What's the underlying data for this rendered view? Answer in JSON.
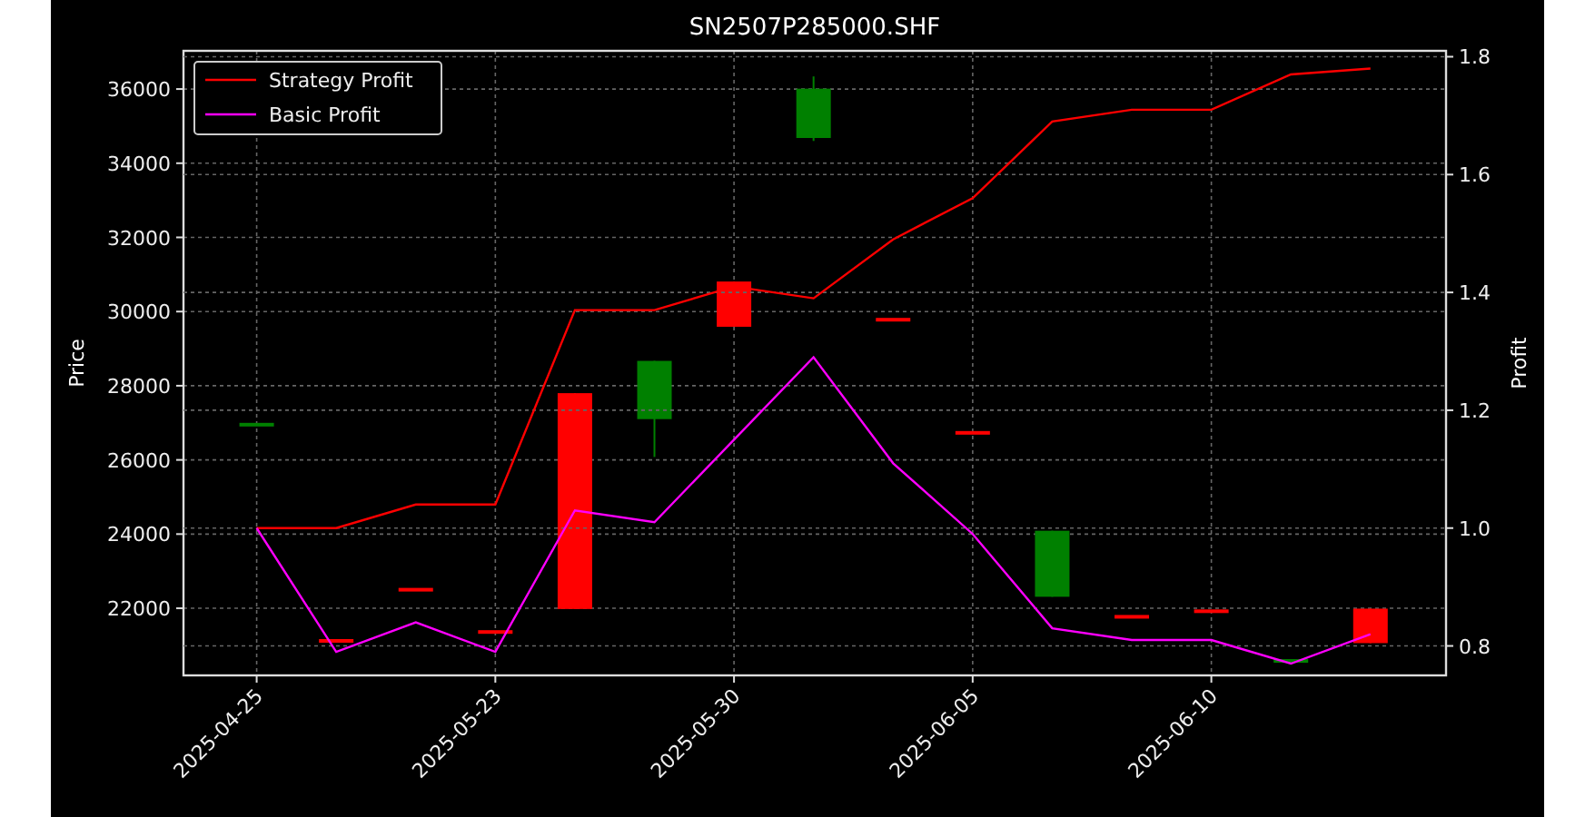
{
  "price_chart": {
    "chart_data": {
      "type": "candlestick",
      "title": "SN2507P285000.SHF",
      "ylabel": "Price",
      "grid": true,
      "categories": [
        "2025-04-25",
        null,
        null,
        "2025-05-23",
        null,
        null,
        "2025-05-30",
        null,
        null,
        "2025-06-05",
        null,
        null,
        "2025-06-10",
        null,
        null
      ],
      "ylim": [
        20190,
        37030
      ],
      "yticks": [
        22000,
        24000,
        26000,
        28000,
        30000,
        32000,
        34000,
        36000
      ],
      "ohlc": [
        [
          26950,
          26950,
          26950,
          26950
        ],
        [
          21120,
          21120,
          21120,
          21120
        ],
        [
          22500,
          22500,
          22500,
          22500
        ],
        [
          21360,
          21360,
          21360,
          21360
        ],
        [
          27800,
          27800,
          21980,
          21980
        ],
        [
          27100,
          28670,
          26080,
          28670
        ],
        [
          30810,
          30810,
          29590,
          29590
        ],
        [
          34680,
          36340,
          34600,
          36010
        ],
        [
          29780,
          29780,
          29780,
          29780
        ],
        [
          26730,
          26730,
          26730,
          26730
        ],
        [
          22310,
          24090,
          22310,
          24090
        ],
        [
          21770,
          21770,
          21770,
          21770
        ],
        [
          21920,
          21920,
          21920,
          21920
        ],
        [
          20580,
          20580,
          20580,
          20580
        ],
        [
          21990,
          21990,
          21060,
          21060
        ]
      ],
      "colors": [
        "#008000",
        "#ff0000",
        "#ff0000",
        "#ff0000",
        "#ff0000",
        "#008000",
        "#ff0000",
        "#008000",
        "#ff0000",
        "#ff0000",
        "#008000",
        "#ff0000",
        "#ff0000",
        "#008000",
        "#ff0000"
      ]
    }
  },
  "profit_chart": {
    "chart_data": {
      "type": "line",
      "ylabel": "Profit",
      "grid": true,
      "legend": "upper left",
      "categories": [
        null,
        null,
        null,
        null,
        null,
        null,
        null,
        null,
        null,
        null,
        null,
        null,
        null,
        null,
        null
      ],
      "ylim": [
        0.75,
        1.81
      ],
      "yticks": [
        {
          "value": 0.8,
          "label": "0.8"
        },
        {
          "value": 1.0,
          "label": "1.0"
        },
        {
          "value": 1.2,
          "label": "1.2"
        },
        {
          "value": 1.4,
          "label": "1.4"
        },
        {
          "value": 1.6,
          "label": "1.6"
        },
        {
          "value": 1.8,
          "label": "1.8"
        }
      ],
      "series": [
        {
          "name": "Strategy Profit",
          "color": "#ff0000",
          "values": [
            1.0,
            1.0,
            1.04,
            1.04,
            1.37,
            1.37,
            1.41,
            1.39,
            1.49,
            1.56,
            1.69,
            1.71,
            1.71,
            1.77,
            1.78
          ]
        },
        {
          "name": "Basic Profit",
          "color": "#ff00ff",
          "values": [
            1.0,
            0.79,
            0.84,
            0.79,
            1.03,
            1.01,
            1.15,
            1.29,
            1.11,
            0.99,
            0.83,
            0.81,
            0.81,
            0.77,
            0.82
          ]
        }
      ]
    }
  }
}
